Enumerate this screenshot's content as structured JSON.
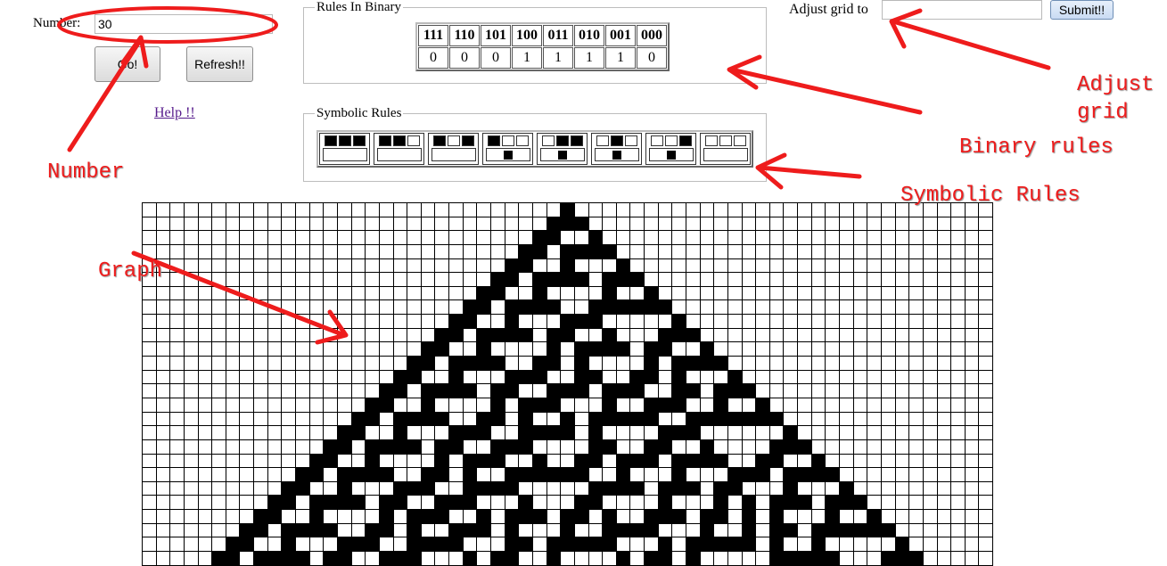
{
  "number_label": "Number:",
  "number_value": "30",
  "go_label": "Go!",
  "refresh_label": "Refresh!!",
  "help_label": "Help !!",
  "adjust_label": "Adjust grid to",
  "adjust_value": "",
  "submit_label": "Submit!!",
  "binary_rules": {
    "legend": "Rules In Binary",
    "patterns": [
      "111",
      "110",
      "101",
      "100",
      "011",
      "010",
      "001",
      "000"
    ],
    "outputs": [
      "0",
      "0",
      "0",
      "1",
      "1",
      "1",
      "1",
      "0"
    ]
  },
  "symbolic_rules": {
    "legend": "Symbolic Rules"
  },
  "annotations": {
    "adjust": "Adjust\ngrid",
    "binary": "Binary rules",
    "symbolic": "Symbolic Rules",
    "number": "Number",
    "graph": "Graph"
  },
  "grid": {
    "columns": 61,
    "rows": 26,
    "rule": 30
  },
  "colors": {
    "annotation": "#ee1c1c",
    "cell_on": "#000000",
    "cell_off": "#ffffff"
  }
}
